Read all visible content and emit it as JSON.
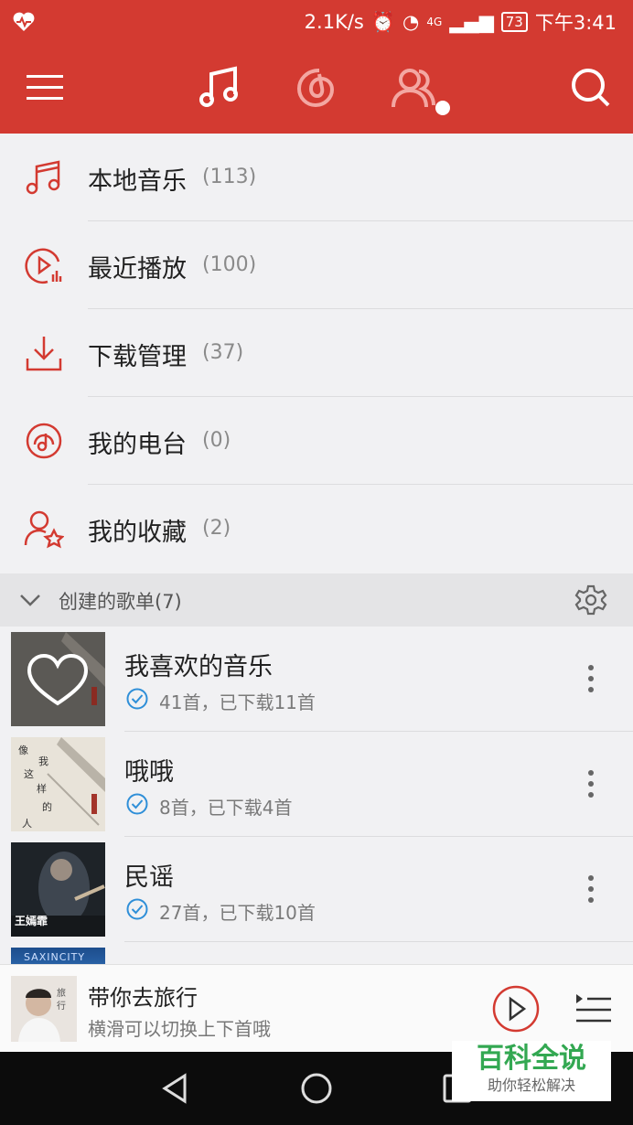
{
  "status_bar": {
    "speed": "2.1K/s",
    "network": "4G",
    "battery": "73",
    "time": "下午3:41"
  },
  "header": {
    "icons": [
      "menu-icon",
      "music-note-icon",
      "netease-cloud-icon",
      "friends-icon",
      "search-icon"
    ],
    "accent_color": "#d33a31"
  },
  "menu": {
    "items": [
      {
        "label": "本地音乐",
        "count": "(113)",
        "icon": "music-note-icon"
      },
      {
        "label": "最近播放",
        "count": "(100)",
        "icon": "recent-play-icon"
      },
      {
        "label": "下载管理",
        "count": "(37)",
        "icon": "download-icon"
      },
      {
        "label": "我的电台",
        "count": "(0)",
        "icon": "radio-icon"
      },
      {
        "label": "我的收藏",
        "count": "(2)",
        "icon": "favorite-user-icon"
      }
    ]
  },
  "section": {
    "title": "创建的歌单(7)"
  },
  "playlists": [
    {
      "name": "我喜欢的音乐",
      "sub": "41首，已下载11首"
    },
    {
      "name": "哦哦",
      "sub": "8首，已下载4首"
    },
    {
      "name": "民谣",
      "sub": "27首，已下载10首"
    }
  ],
  "player": {
    "song": "带你去旅行",
    "hint": "横滑可以切换上下首哦"
  },
  "watermark": {
    "title": "百科全说",
    "subtitle": "助你轻松解决"
  }
}
